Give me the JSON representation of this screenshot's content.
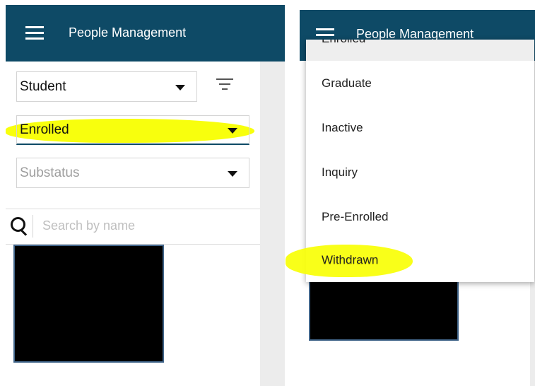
{
  "app": {
    "title": "People Management"
  },
  "filters": {
    "type_value": "Student",
    "status_value": "Enrolled",
    "substatus_placeholder": "Substatus"
  },
  "search": {
    "placeholder": "Search by name"
  },
  "status_menu": {
    "items": [
      {
        "label": "Enrolled",
        "selected": true
      },
      {
        "label": "Graduate"
      },
      {
        "label": "Inactive"
      },
      {
        "label": "Inquiry"
      },
      {
        "label": "Pre-Enrolled"
      },
      {
        "label": "Withdrawn"
      }
    ]
  },
  "colors": {
    "app_bar": "#0e4a66",
    "highlight": "#f8ff00",
    "redaction": "#000000"
  },
  "icons": [
    "menu-icon",
    "filter-icon",
    "search-icon",
    "caret-down-icon"
  ]
}
